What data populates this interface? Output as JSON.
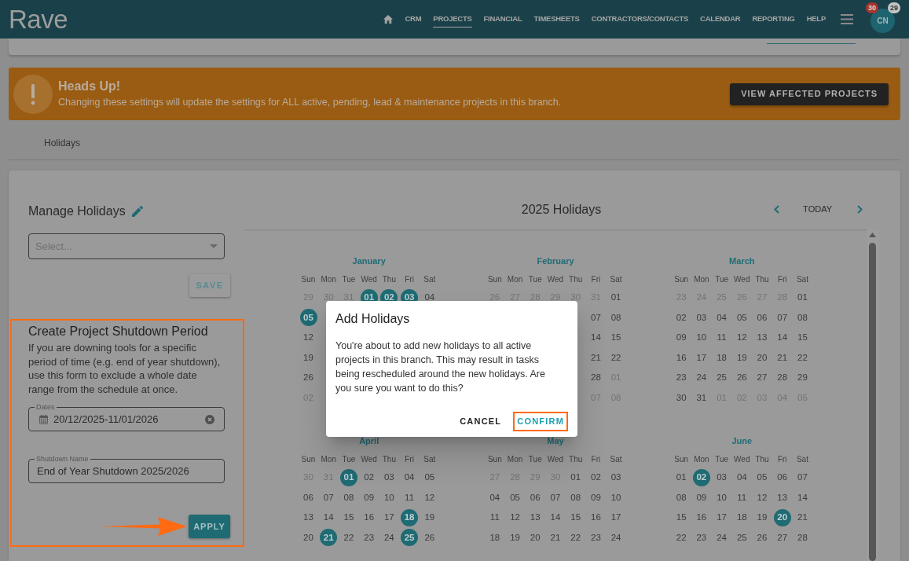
{
  "nav": {
    "logo": "Rave",
    "items": [
      {
        "label": "CRM",
        "selected": false
      },
      {
        "label": "PROJECTS",
        "selected": true
      },
      {
        "label": "FINANCIAL",
        "selected": false
      },
      {
        "label": "TIMESHEETS",
        "selected": false
      },
      {
        "label": "CONTRACTORS/CONTACTS",
        "selected": false
      },
      {
        "label": "CALENDAR",
        "selected": false
      },
      {
        "label": "REPORTING",
        "selected": false
      },
      {
        "label": "HELP",
        "selected": false
      }
    ],
    "avatar": {
      "initials": "CN",
      "badges": [
        {
          "count": "30",
          "color": "#a8342b"
        },
        {
          "count": "29",
          "color": "#c4c4c4"
        }
      ]
    }
  },
  "banner": {
    "title": "Heads Up!",
    "message": "Changing these settings will update the settings for ALL active, pending, lead & maintenance projects in this branch.",
    "button": "VIEW AFFECTED PROJECTS"
  },
  "tab": "Holidays",
  "manage_holidays": {
    "title": "Manage Holidays",
    "select": {
      "placeholder": "Select..."
    },
    "save_button": "SAVE"
  },
  "shutdown_period": {
    "highlighted": true,
    "title": "Create Project Shutdown Period",
    "description": "If you are downing tools for a specific period of time (e.g. end of year shutdown), use this form to exclude a whole date range from the schedule at once.",
    "dates": {
      "label": "Dates",
      "value": "20/12/2025-11/01/2026"
    },
    "name": {
      "label": "Shutdown Name",
      "value": "End of Year Shutdown 2025/2026"
    },
    "apply_button": {
      "label": "APPLY",
      "annotated": true
    }
  },
  "calendar": {
    "title": "2025 Holidays",
    "today_button": "TODAY",
    "months": [
      {
        "name": "January",
        "weekdays": [
          "Sun",
          "Mon",
          "Tue",
          "Wed",
          "Thu",
          "Fri",
          "Sat"
        ],
        "weeks": [
          [
            {
              "day": "29",
              "kind": "outside"
            },
            {
              "day": "30",
              "kind": "outside"
            },
            {
              "day": "31",
              "kind": "outside"
            },
            {
              "day": "01",
              "kind": "holiday"
            },
            {
              "day": "02",
              "kind": "holiday"
            },
            {
              "day": "03",
              "kind": "holiday"
            },
            {
              "day": "04",
              "kind": "day"
            }
          ],
          [
            {
              "day": "05",
              "kind": "holiday"
            },
            {
              "kind": "covered"
            },
            {
              "kind": "covered"
            },
            {
              "kind": "covered"
            },
            {
              "kind": "covered"
            },
            {
              "kind": "covered"
            },
            {
              "kind": "covered"
            }
          ],
          [
            {
              "day": "12",
              "kind": "day"
            },
            {
              "kind": "covered"
            },
            {
              "kind": "covered"
            },
            {
              "kind": "covered"
            },
            {
              "kind": "covered"
            },
            {
              "kind": "covered"
            },
            {
              "kind": "covered"
            }
          ],
          [
            {
              "day": "19",
              "kind": "day"
            },
            {
              "kind": "covered"
            },
            {
              "kind": "covered"
            },
            {
              "kind": "covered"
            },
            {
              "kind": "covered"
            },
            {
              "kind": "covered"
            },
            {
              "kind": "covered"
            }
          ],
          [
            {
              "day": "26",
              "kind": "day"
            },
            {
              "kind": "covered"
            },
            {
              "kind": "covered"
            },
            {
              "kind": "covered"
            },
            {
              "kind": "covered"
            },
            {
              "kind": "covered"
            },
            {
              "kind": "covered"
            }
          ],
          [
            {
              "day": "02",
              "kind": "outside"
            },
            {
              "kind": "covered"
            },
            {
              "kind": "covered"
            },
            {
              "kind": "covered"
            },
            {
              "kind": "covered"
            },
            {
              "kind": "covered"
            },
            {
              "kind": "covered"
            }
          ]
        ]
      },
      {
        "name": "February",
        "weekdays": [
          "Sun",
          "Mon",
          "Tue",
          "Wed",
          "Thu",
          "Fri",
          "Sat"
        ],
        "weeks": [
          [
            {
              "day": "26",
              "kind": "outside"
            },
            {
              "day": "27",
              "kind": "outside"
            },
            {
              "day": "28",
              "kind": "outside"
            },
            {
              "day": "29",
              "kind": "outside"
            },
            {
              "day": "30",
              "kind": "outside"
            },
            {
              "day": "31",
              "kind": "outside"
            },
            {
              "day": "01",
              "kind": "day"
            }
          ],
          [
            {
              "kind": "covered"
            },
            {
              "kind": "covered"
            },
            {
              "kind": "covered"
            },
            {
              "kind": "covered"
            },
            {
              "kind": "covered"
            },
            {
              "day": "07",
              "kind": "day"
            },
            {
              "day": "08",
              "kind": "day"
            }
          ],
          [
            {
              "kind": "covered"
            },
            {
              "kind": "covered"
            },
            {
              "kind": "covered"
            },
            {
              "kind": "covered"
            },
            {
              "kind": "covered"
            },
            {
              "day": "14",
              "kind": "day"
            },
            {
              "day": "15",
              "kind": "day"
            }
          ],
          [
            {
              "kind": "covered"
            },
            {
              "kind": "covered"
            },
            {
              "kind": "covered"
            },
            {
              "kind": "covered"
            },
            {
              "kind": "covered"
            },
            {
              "day": "21",
              "kind": "day"
            },
            {
              "day": "22",
              "kind": "day"
            }
          ],
          [
            {
              "kind": "covered"
            },
            {
              "kind": "covered"
            },
            {
              "kind": "covered"
            },
            {
              "kind": "covered"
            },
            {
              "kind": "covered"
            },
            {
              "day": "28",
              "kind": "day"
            },
            {
              "day": "01",
              "kind": "outside"
            }
          ],
          [
            {
              "kind": "covered"
            },
            {
              "kind": "covered"
            },
            {
              "kind": "covered"
            },
            {
              "kind": "covered"
            },
            {
              "kind": "covered"
            },
            {
              "day": "07",
              "kind": "outside"
            },
            {
              "day": "08",
              "kind": "outside"
            }
          ]
        ]
      },
      {
        "name": "March",
        "weekdays": [
          "Sun",
          "Mon",
          "Tue",
          "Wed",
          "Thu",
          "Fri",
          "Sat"
        ],
        "weeks": [
          [
            {
              "day": "23",
              "kind": "outside"
            },
            {
              "day": "24",
              "kind": "outside"
            },
            {
              "day": "25",
              "kind": "outside"
            },
            {
              "day": "26",
              "kind": "outside"
            },
            {
              "day": "27",
              "kind": "outside"
            },
            {
              "day": "28",
              "kind": "outside"
            },
            {
              "day": "01",
              "kind": "day"
            }
          ],
          [
            {
              "day": "02",
              "kind": "day"
            },
            {
              "day": "03",
              "kind": "day"
            },
            {
              "day": "04",
              "kind": "day"
            },
            {
              "day": "05",
              "kind": "day"
            },
            {
              "day": "06",
              "kind": "day"
            },
            {
              "day": "07",
              "kind": "day"
            },
            {
              "day": "08",
              "kind": "day"
            }
          ],
          [
            {
              "day": "09",
              "kind": "day"
            },
            {
              "day": "10",
              "kind": "day"
            },
            {
              "day": "11",
              "kind": "day"
            },
            {
              "day": "12",
              "kind": "day"
            },
            {
              "day": "13",
              "kind": "day"
            },
            {
              "day": "14",
              "kind": "day"
            },
            {
              "day": "15",
              "kind": "day"
            }
          ],
          [
            {
              "day": "16",
              "kind": "day"
            },
            {
              "day": "17",
              "kind": "day"
            },
            {
              "day": "18",
              "kind": "day"
            },
            {
              "day": "19",
              "kind": "day"
            },
            {
              "day": "20",
              "kind": "day"
            },
            {
              "day": "21",
              "kind": "day"
            },
            {
              "day": "22",
              "kind": "day"
            }
          ],
          [
            {
              "day": "23",
              "kind": "day"
            },
            {
              "day": "24",
              "kind": "day"
            },
            {
              "day": "25",
              "kind": "day"
            },
            {
              "day": "26",
              "kind": "day"
            },
            {
              "day": "27",
              "kind": "day"
            },
            {
              "day": "28",
              "kind": "day"
            },
            {
              "day": "29",
              "kind": "day"
            }
          ],
          [
            {
              "day": "30",
              "kind": "day"
            },
            {
              "day": "31",
              "kind": "day"
            },
            {
              "day": "01",
              "kind": "outside"
            },
            {
              "day": "02",
              "kind": "outside"
            },
            {
              "day": "03",
              "kind": "outside"
            },
            {
              "day": "04",
              "kind": "outside"
            },
            {
              "day": "05",
              "kind": "outside"
            }
          ]
        ]
      },
      {
        "name": "April",
        "weekdays": [
          "Sun",
          "Mon",
          "Tue",
          "Wed",
          "Thu",
          "Fri",
          "Sat"
        ],
        "weeks": [
          [
            {
              "day": "30",
              "kind": "outside"
            },
            {
              "day": "31",
              "kind": "outside"
            },
            {
              "day": "01",
              "kind": "holiday"
            },
            {
              "day": "02",
              "kind": "day"
            },
            {
              "day": "03",
              "kind": "day"
            },
            {
              "day": "04",
              "kind": "day"
            },
            {
              "day": "05",
              "kind": "day"
            }
          ],
          [
            {
              "day": "06",
              "kind": "day"
            },
            {
              "day": "07",
              "kind": "day"
            },
            {
              "day": "08",
              "kind": "day"
            },
            {
              "day": "09",
              "kind": "day"
            },
            {
              "day": "10",
              "kind": "day"
            },
            {
              "day": "11",
              "kind": "day"
            },
            {
              "day": "12",
              "kind": "day"
            }
          ],
          [
            {
              "day": "13",
              "kind": "day"
            },
            {
              "day": "14",
              "kind": "day"
            },
            {
              "day": "15",
              "kind": "day"
            },
            {
              "day": "16",
              "kind": "day"
            },
            {
              "day": "17",
              "kind": "day"
            },
            {
              "day": "18",
              "kind": "holiday"
            },
            {
              "day": "19",
              "kind": "day"
            }
          ],
          [
            {
              "day": "20",
              "kind": "day"
            },
            {
              "day": "21",
              "kind": "holiday"
            },
            {
              "day": "22",
              "kind": "day"
            },
            {
              "day": "23",
              "kind": "day"
            },
            {
              "day": "24",
              "kind": "day"
            },
            {
              "day": "25",
              "kind": "holiday"
            },
            {
              "day": "26",
              "kind": "day"
            }
          ]
        ]
      },
      {
        "name": "May",
        "weekdays": [
          "Sun",
          "Mon",
          "Tue",
          "Wed",
          "Thu",
          "Fri",
          "Sat"
        ],
        "weeks": [
          [
            {
              "day": "27",
              "kind": "outside"
            },
            {
              "day": "28",
              "kind": "outside"
            },
            {
              "day": "29",
              "kind": "outside"
            },
            {
              "day": "30",
              "kind": "outside"
            },
            {
              "day": "01",
              "kind": "day"
            },
            {
              "day": "02",
              "kind": "day"
            },
            {
              "day": "03",
              "kind": "day"
            }
          ],
          [
            {
              "day": "04",
              "kind": "day"
            },
            {
              "day": "05",
              "kind": "day"
            },
            {
              "day": "06",
              "kind": "day"
            },
            {
              "day": "07",
              "kind": "day"
            },
            {
              "day": "08",
              "kind": "day"
            },
            {
              "day": "09",
              "kind": "day"
            },
            {
              "day": "10",
              "kind": "day"
            }
          ],
          [
            {
              "day": "11",
              "kind": "day"
            },
            {
              "day": "12",
              "kind": "day"
            },
            {
              "day": "13",
              "kind": "day"
            },
            {
              "day": "14",
              "kind": "day"
            },
            {
              "day": "15",
              "kind": "day"
            },
            {
              "day": "16",
              "kind": "day"
            },
            {
              "day": "17",
              "kind": "day"
            }
          ],
          [
            {
              "day": "18",
              "kind": "day"
            },
            {
              "day": "19",
              "kind": "day"
            },
            {
              "day": "20",
              "kind": "day"
            },
            {
              "day": "21",
              "kind": "day"
            },
            {
              "day": "22",
              "kind": "day"
            },
            {
              "day": "23",
              "kind": "day"
            },
            {
              "day": "24",
              "kind": "day"
            }
          ]
        ]
      },
      {
        "name": "June",
        "weekdays": [
          "Sun",
          "Mon",
          "Tue",
          "Wed",
          "Thu",
          "Fri",
          "Sat"
        ],
        "weeks": [
          [
            {
              "day": "01",
              "kind": "day"
            },
            {
              "day": "02",
              "kind": "holiday"
            },
            {
              "day": "03",
              "kind": "day"
            },
            {
              "day": "04",
              "kind": "day"
            },
            {
              "day": "05",
              "kind": "day"
            },
            {
              "day": "06",
              "kind": "day"
            },
            {
              "day": "07",
              "kind": "day"
            }
          ],
          [
            {
              "day": "08",
              "kind": "day"
            },
            {
              "day": "09",
              "kind": "day"
            },
            {
              "day": "10",
              "kind": "day"
            },
            {
              "day": "11",
              "kind": "day"
            },
            {
              "day": "12",
              "kind": "day"
            },
            {
              "day": "13",
              "kind": "day"
            },
            {
              "day": "14",
              "kind": "day"
            }
          ],
          [
            {
              "day": "15",
              "kind": "day"
            },
            {
              "day": "16",
              "kind": "day"
            },
            {
              "day": "17",
              "kind": "day"
            },
            {
              "day": "18",
              "kind": "day"
            },
            {
              "day": "19",
              "kind": "day"
            },
            {
              "day": "20",
              "kind": "holiday"
            },
            {
              "day": "21",
              "kind": "day"
            }
          ],
          [
            {
              "day": "22",
              "kind": "day"
            },
            {
              "day": "23",
              "kind": "day"
            },
            {
              "day": "24",
              "kind": "day"
            },
            {
              "day": "25",
              "kind": "day"
            },
            {
              "day": "26",
              "kind": "day"
            },
            {
              "day": "27",
              "kind": "day"
            },
            {
              "day": "28",
              "kind": "day"
            }
          ]
        ]
      }
    ]
  },
  "dialog": {
    "title": "Add Holidays",
    "message": "You're about to add new holidays to all active projects in this branch. This may result in tasks being rescheduled around the new holidays. Are you sure you want to do this?",
    "buttons": [
      {
        "label": "CANCEL",
        "kind": "text",
        "highlighted": false
      },
      {
        "label": "CONFIRM",
        "kind": "confirm",
        "highlighted": true
      }
    ]
  }
}
